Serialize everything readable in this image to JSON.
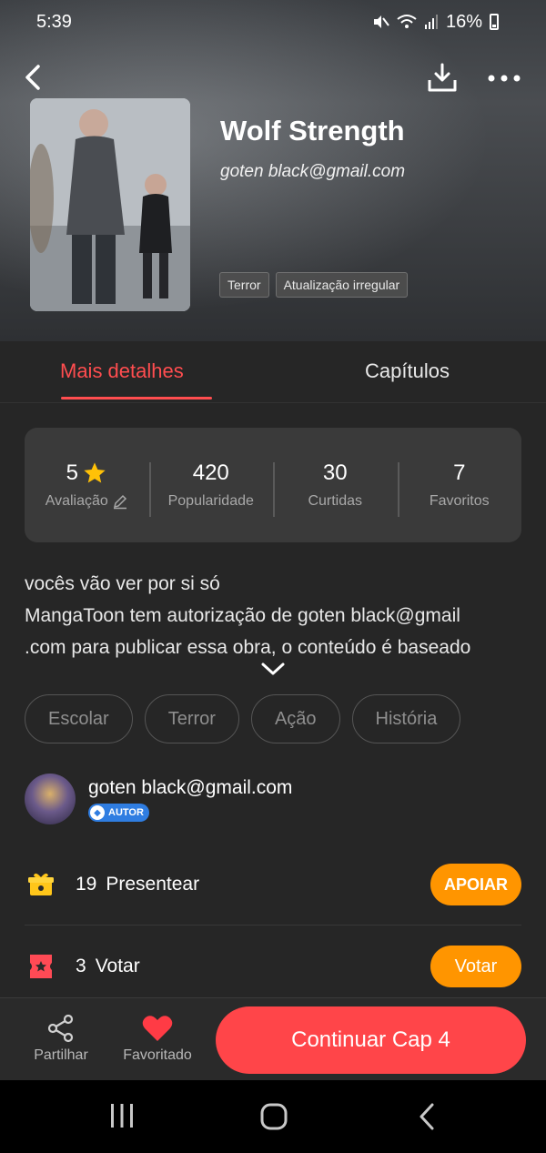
{
  "status_bar": {
    "time": "5:39",
    "battery": "16%"
  },
  "header": {
    "title": "Wolf Strength",
    "author": "goten black@gmail.com",
    "tags": [
      "Terror",
      "Atualização irregular"
    ]
  },
  "tabs": {
    "details": "Mais detalhes",
    "chapters": "Capítulos",
    "active": "Mais detalhes"
  },
  "stats": [
    {
      "value": "5",
      "label": "Avaliação"
    },
    {
      "value": "420",
      "label": "Popularidade"
    },
    {
      "value": "30",
      "label": "Curtidas"
    },
    {
      "value": "7",
      "label": "Favoritos"
    }
  ],
  "description": {
    "line1": "vocês vão ver por si só",
    "line2": "MangaToon tem autorização de goten black@gmail",
    "line3": ".com para publicar essa obra, o conteúdo é baseado"
  },
  "genres": [
    "Escolar",
    "Terror",
    "Ação",
    "História"
  ],
  "author_row": {
    "name": "goten black@gmail.com",
    "badge": "AUTOR"
  },
  "gift_row": {
    "count": "19",
    "label": "Presentear",
    "button": "APOIAR"
  },
  "vote_row": {
    "count": "3",
    "label": "Votar",
    "button": "Votar"
  },
  "bottom_bar": {
    "share": "Partilhar",
    "favorite": "Favoritado",
    "continue": "Continuar Cap 4"
  },
  "colors": {
    "accent": "#ff4d4f",
    "orange": "#ff9500",
    "background": "#262626"
  },
  "icons": [
    "back-icon",
    "download-icon",
    "more-icon",
    "star-icon",
    "edit-icon",
    "chevron-down-icon",
    "gift-icon",
    "ticket-icon",
    "share-icon",
    "heart-icon"
  ]
}
